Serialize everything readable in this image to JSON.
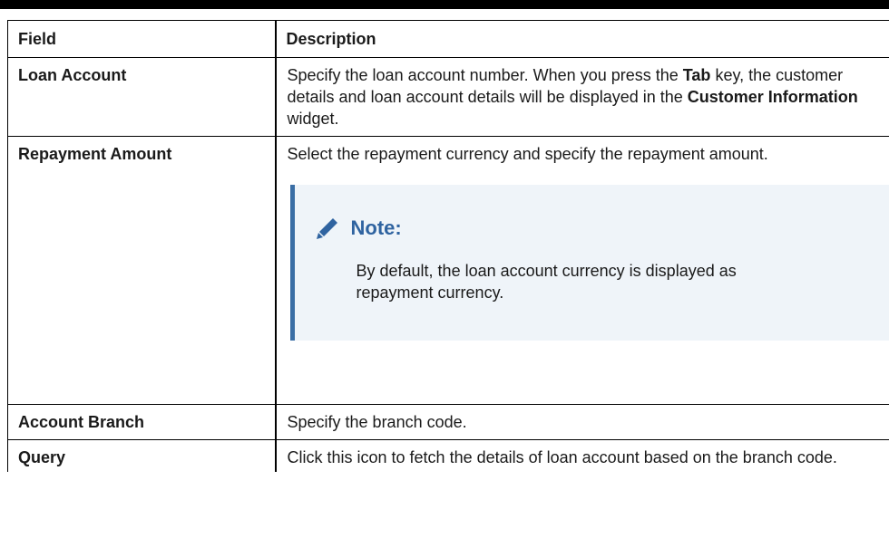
{
  "table": {
    "headers": {
      "field": "Field",
      "description": "Description"
    },
    "rows": [
      {
        "field": "Loan Account",
        "description": {
          "t1": "Specify the loan account number. When you press the ",
          "b1": "Tab",
          "t2": " key, the customer details and loan account details will be displayed in the ",
          "b2": "Customer Information",
          "t3": " widget."
        }
      },
      {
        "field": "Repayment Amount",
        "description": "Select the repayment currency and specify the repayment amount.",
        "note": {
          "icon": "pencil-icon",
          "title": "Note:",
          "body": "By default, the loan account currency is displayed as repayment currency.",
          "accent_color": "#3a6ea5",
          "background_color": "#eff4f9"
        }
      },
      {
        "field": "Account Branch",
        "description": "Specify the branch code."
      },
      {
        "field": "Query",
        "description": "Click this icon to fetch the details of loan account based on the branch code."
      }
    ]
  }
}
